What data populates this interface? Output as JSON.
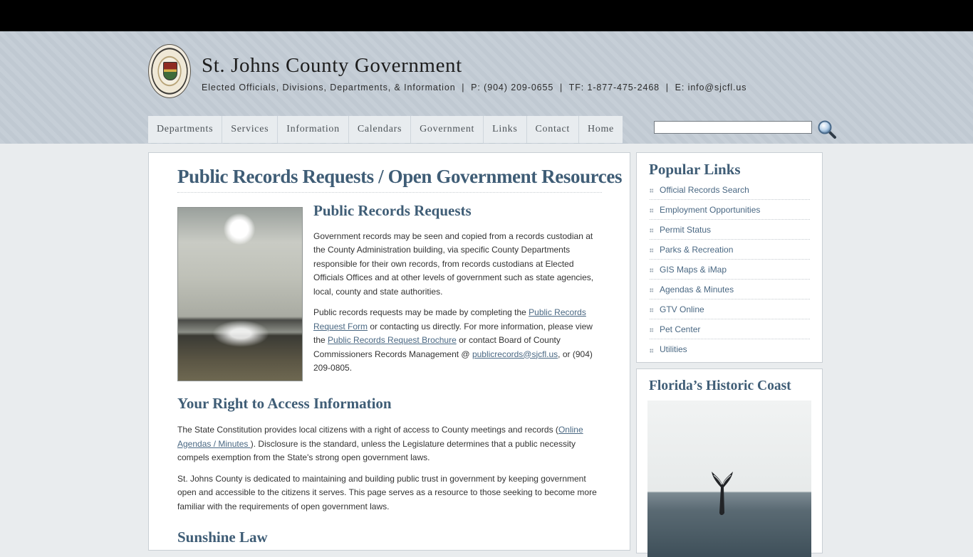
{
  "header": {
    "site_title": "St. Johns County Government",
    "tagline_prefix": "Elected Officials, Divisions, Departments, & Information  |  P: (904) 209-0655  |  TF: 1-877-475-2468  |  E: ",
    "email": "info@sjcfl.us",
    "seal_icon": "county-seal"
  },
  "nav": {
    "items": [
      "Departments",
      "Services",
      "Information",
      "Calendars",
      "Government",
      "Links",
      "Contact",
      "Home"
    ]
  },
  "search": {
    "value": "",
    "icon": "search-icon"
  },
  "main": {
    "page_title": "Public Records Requests / Open Government Resources",
    "section1": {
      "heading": "Public Records Requests",
      "p1": "Government records may be seen and copied from a records custodian at the County Administration building, via specific County Departments responsible for their own records, from records custodians at Elected Officials Offices and at other levels of government such as state agencies, local, county and state authorities.",
      "p2_a": "Public records requests may be made by completing the ",
      "p2_link1": "Public Records Request Form",
      "p2_b": " or contacting us directly. For more information, please view the ",
      "p2_link2": "Public Records Request Brochure",
      "p2_c": " or contact Board of County Commissioners Records Management @ ",
      "p2_link3": "publicrecords@sjcfl.us",
      "p2_d": ", or (904) 209-0805."
    },
    "section2": {
      "heading": "Your Right to Access Information",
      "p1_a": "The State Constitution provides local citizens with a right of access to County meetings and records  (",
      "p1_link": "Online Agendas / Minutes ",
      "p1_b": "). Disclosure is the standard, unless the Legislature determines that a public necessity compels exemption from the State's strong open government laws.",
      "p2": "St. Johns County is dedicated to maintaining and building public trust in government by keeping government open and accessible to the citizens it serves. This page serves as a resource to those seeking to become more familiar with the requirements of open government laws."
    },
    "section3": {
      "heading": "Sunshine Law"
    }
  },
  "sidebar": {
    "popular_title": "Popular Links",
    "links": [
      "Official Records Search",
      "Employment Opportunities",
      "Permit Status",
      "Parks & Recreation",
      "GIS Maps & iMap",
      "Agendas & Minutes",
      "GTV Online",
      "Pet Center",
      "Utilities"
    ],
    "coast_title": "Florida’s Historic Coast"
  },
  "colors": {
    "heading": "#3f5d76",
    "link": "#4a6883",
    "header_bg": "#c3ccd5"
  }
}
